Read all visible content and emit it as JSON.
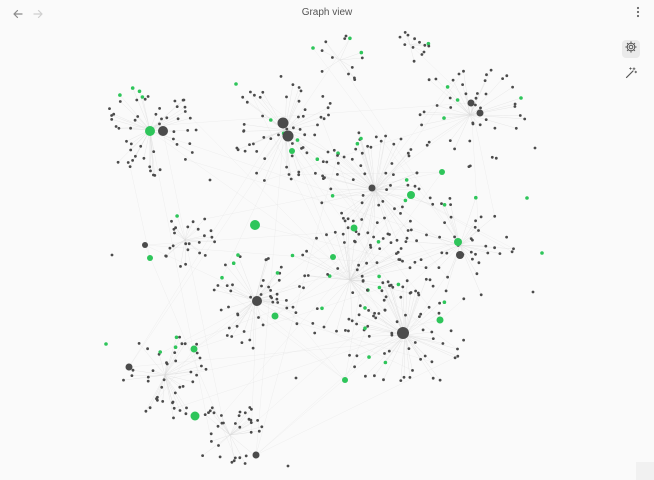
{
  "header": {
    "title": "Graph view",
    "back_icon": "arrow-left-icon",
    "forward_icon": "arrow-right-icon",
    "more_icon": "more-vertical-icon"
  },
  "tools": [
    {
      "icon": "settings-gear-icon",
      "active": true
    },
    {
      "icon": "magic-wand-icon",
      "active": false
    }
  ],
  "colors": {
    "node": "#4b4b4b",
    "accent": "#2ec55a",
    "edge": "#d8d8d8",
    "background": "#fafafa"
  }
}
